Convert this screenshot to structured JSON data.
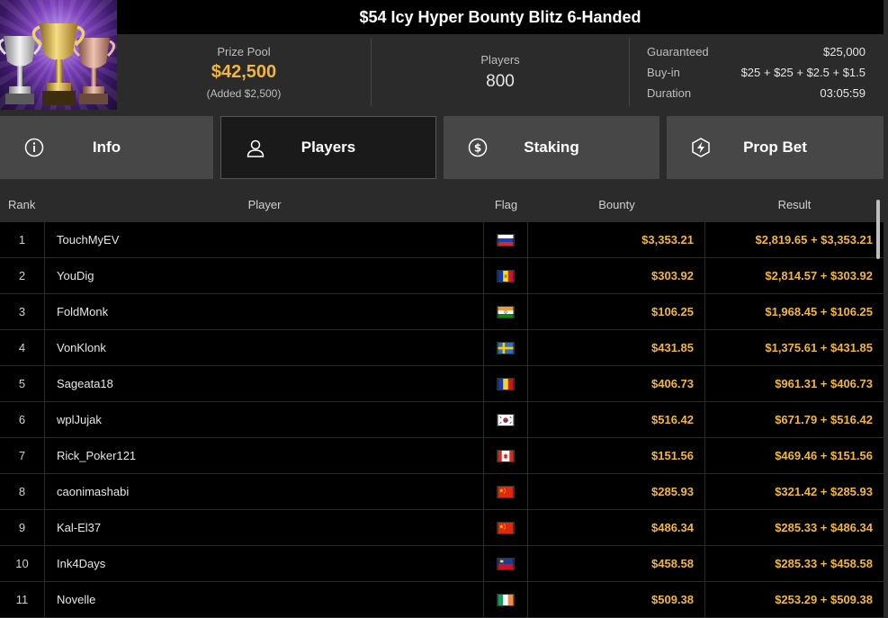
{
  "tournament": {
    "title": "$54 Icy Hyper Bounty Blitz 6-Handed"
  },
  "stats": {
    "prize_label": "Prize Pool",
    "prize_value": "$42,500",
    "prize_added": "(Added $2,500)",
    "players_label": "Players",
    "players_value": "800",
    "details": [
      {
        "label": "Guaranteed",
        "value": "$25,000"
      },
      {
        "label": "Buy-in",
        "value": "$25 + $25 + $2.5 + $1.5"
      },
      {
        "label": "Duration",
        "value": "03:05:59"
      }
    ]
  },
  "tabs": [
    {
      "label": "Info",
      "icon": "info-icon",
      "active": false
    },
    {
      "label": "Players",
      "icon": "user-icon",
      "active": true
    },
    {
      "label": "Staking",
      "icon": "dollar-coin-icon",
      "active": false
    },
    {
      "label": "Prop Bet",
      "icon": "lightning-shield-icon",
      "active": false
    }
  ],
  "table": {
    "headers": {
      "rank": "Rank",
      "player": "Player",
      "flag": "Flag",
      "bounty": "Bounty",
      "result": "Result"
    },
    "rows": [
      {
        "rank": "1",
        "player": "TouchMyEV",
        "flag": "russia",
        "bounty": "$3,353.21",
        "result": "$2,819.65 + $3,353.21"
      },
      {
        "rank": "2",
        "player": "YouDig",
        "flag": "andorra",
        "bounty": "$303.92",
        "result": "$2,814.57 + $303.92"
      },
      {
        "rank": "3",
        "player": "FoldMonk",
        "flag": "india",
        "bounty": "$106.25",
        "result": "$1,968.45 + $106.25"
      },
      {
        "rank": "4",
        "player": "VonKlonk",
        "flag": "sweden",
        "bounty": "$431.85",
        "result": "$1,375.61 + $431.85"
      },
      {
        "rank": "5",
        "player": "Sageata18",
        "flag": "romania",
        "bounty": "$406.73",
        "result": "$961.31 + $406.73"
      },
      {
        "rank": "6",
        "player": "wplJujak",
        "flag": "south-korea",
        "bounty": "$516.42",
        "result": "$671.79 + $516.42"
      },
      {
        "rank": "7",
        "player": "Rick_Poker121",
        "flag": "canada",
        "bounty": "$151.56",
        "result": "$469.46 + $151.56"
      },
      {
        "rank": "8",
        "player": "caonimashabi",
        "flag": "china",
        "bounty": "$285.93",
        "result": "$321.42 + $285.93"
      },
      {
        "rank": "9",
        "player": "Kal-El37",
        "flag": "china",
        "bounty": "$486.34",
        "result": "$285.33 + $486.34"
      },
      {
        "rank": "10",
        "player": "Ink4Days",
        "flag": "liechtenstein",
        "bounty": "$458.58",
        "result": "$285.33 + $458.58"
      },
      {
        "rank": "11",
        "player": "Novelle",
        "flag": "ireland",
        "bounty": "$509.38",
        "result": "$253.29 + $509.38"
      }
    ]
  },
  "colors": {
    "accent_gold": "#f2b640",
    "background": "#2b2b2b",
    "table_bg": "#000000"
  }
}
